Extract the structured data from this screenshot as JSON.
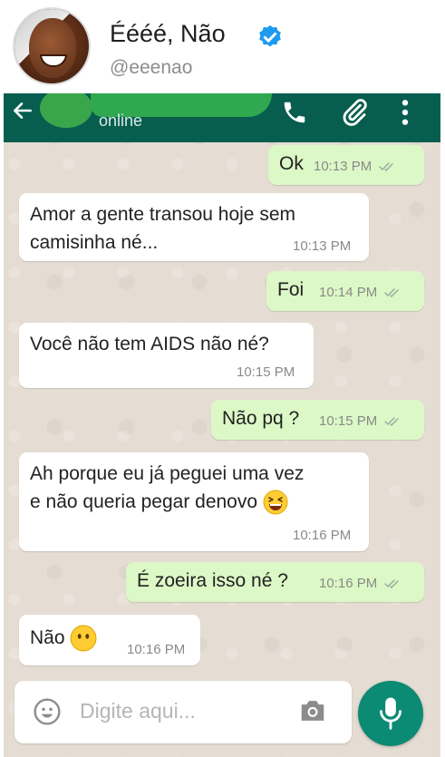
{
  "post": {
    "display_name": "Éééé, Não",
    "handle": "@eeenao"
  },
  "chat": {
    "contact_status": "online",
    "messages": [
      {
        "direction": "out",
        "text": "Ok",
        "time": "10:13 PM",
        "read": true
      },
      {
        "direction": "in",
        "text_lines": [
          "Amor a gente transou hoje sem",
          "camisinha né..."
        ],
        "time": "10:13 PM"
      },
      {
        "direction": "out",
        "text": "Foi",
        "time": "10:14 PM",
        "read": true
      },
      {
        "direction": "in",
        "text": "Você não tem AIDS não né?",
        "time": "10:15 PM"
      },
      {
        "direction": "out",
        "text": "Não pq ?",
        "time": "10:15 PM",
        "read": true
      },
      {
        "direction": "in",
        "text_lines": [
          "Ah porque eu já peguei uma vez",
          "e não queria pegar denovo"
        ],
        "emoji": "laughing-emoji",
        "time": "10:16 PM"
      },
      {
        "direction": "out",
        "text": "É zoeira isso né ?",
        "time": "10:16 PM",
        "read": true
      },
      {
        "direction": "in",
        "text": "Não",
        "emoji": "no-mouth-emoji",
        "time": "10:16 PM"
      }
    ],
    "input_placeholder": "Digite aqui...",
    "icons": {
      "back": "arrow-left-icon",
      "call": "phone-icon",
      "attach": "paperclip-icon",
      "menu": "kebab-menu-icon",
      "emoji": "smiley-icon",
      "camera": "camera-icon",
      "mic": "microphone-icon",
      "verified": "verified-badge-icon"
    },
    "colors": {
      "header": "#075e4f",
      "outgoing_bubble": "#dcf8c6",
      "incoming_bubble": "#ffffff",
      "mic_button": "#0b8a74",
      "verified": "#1d9bf0"
    }
  }
}
